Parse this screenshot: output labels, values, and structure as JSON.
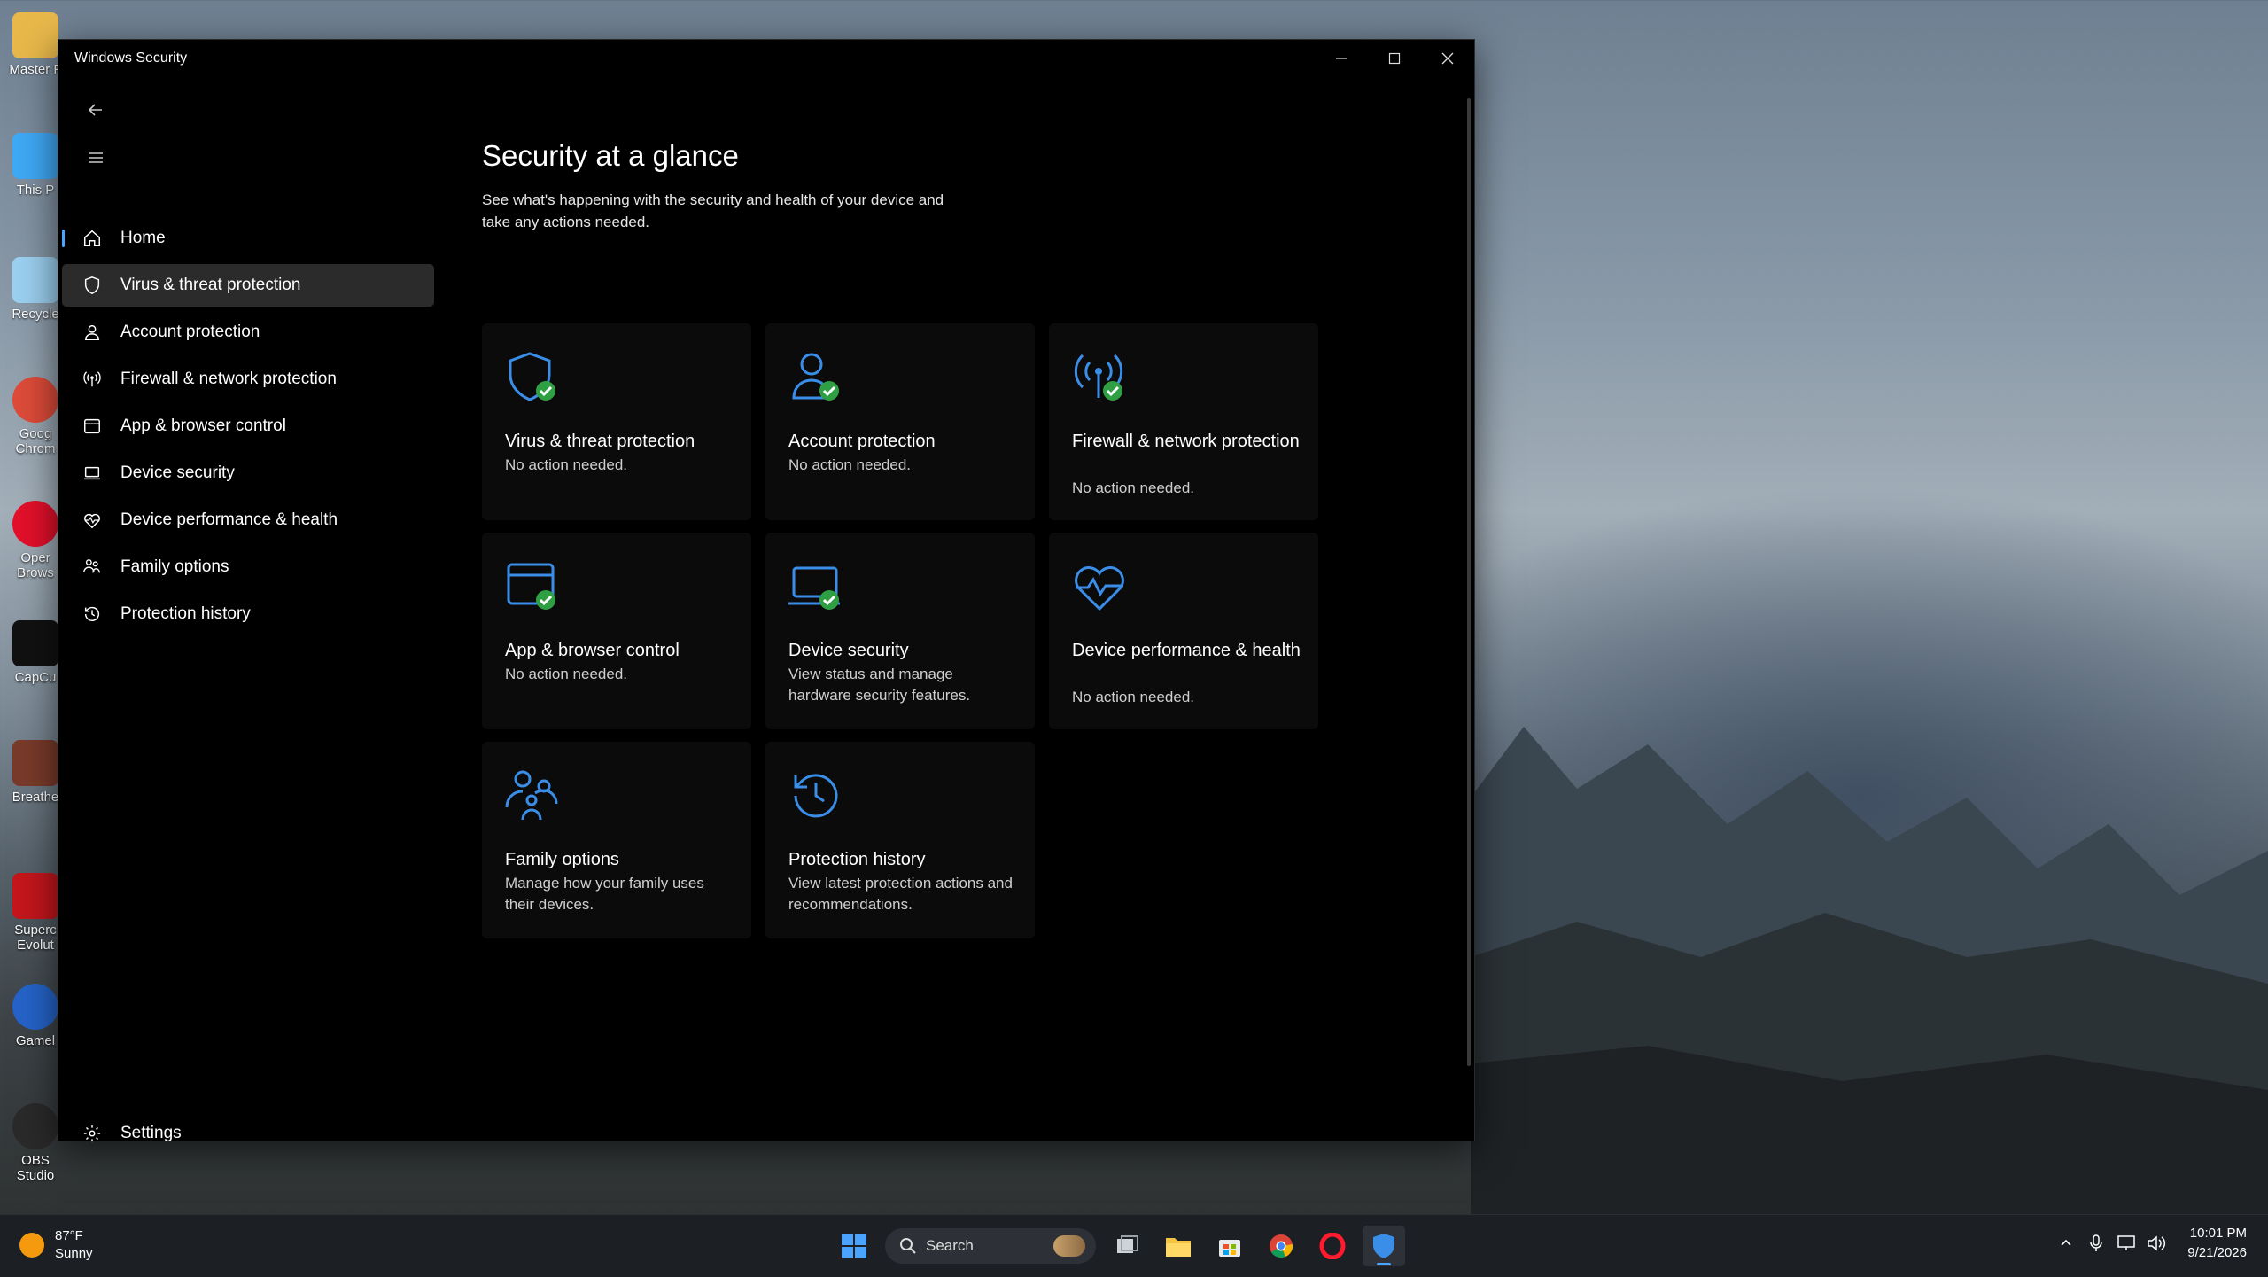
{
  "window": {
    "title": "Windows Security"
  },
  "nav": {
    "items": [
      {
        "label": "Home",
        "icon": "home-icon"
      },
      {
        "label": "Virus & threat protection",
        "icon": "shield-icon"
      },
      {
        "label": "Account protection",
        "icon": "person-icon"
      },
      {
        "label": "Firewall & network protection",
        "icon": "antenna-icon"
      },
      {
        "label": "App & browser control",
        "icon": "app-window-icon"
      },
      {
        "label": "Device security",
        "icon": "laptop-icon"
      },
      {
        "label": "Device performance & health",
        "icon": "heart-pulse-icon"
      },
      {
        "label": "Family options",
        "icon": "family-icon"
      },
      {
        "label": "Protection history",
        "icon": "history-icon"
      }
    ],
    "settings_label": "Settings"
  },
  "main": {
    "title": "Security at a glance",
    "subtitle": "See what's happening with the security and health of your device and take any actions needed.",
    "tiles": [
      {
        "name": "Virus & threat protection",
        "status": "No action needed.",
        "icon": "shield-check-icon"
      },
      {
        "name": "Account protection",
        "status": "No action needed.",
        "icon": "person-check-icon"
      },
      {
        "name": "Firewall & network protection",
        "status": "No action needed.",
        "icon": "antenna-check-icon"
      },
      {
        "name": "App & browser control",
        "status": "No action needed.",
        "icon": "app-window-check-icon"
      },
      {
        "name": "Device security",
        "status": "View status and manage hardware security features.",
        "icon": "laptop-check-icon"
      },
      {
        "name": "Device performance & health",
        "status": "No action needed.",
        "icon": "heart-pulse-icon"
      },
      {
        "name": "Family options",
        "status": "Manage how your family uses their devices.",
        "icon": "family-icon"
      },
      {
        "name": "Protection history",
        "status": "View latest protection actions and recommendations.",
        "icon": "history-icon"
      }
    ]
  },
  "desktop": {
    "icons": [
      "Master F",
      "This P",
      "Recycle",
      "Goog Chrom",
      "Oper Brows",
      "CapCu",
      "Breathe",
      "Superc Evolut",
      "Gamel",
      "OBS Studio"
    ]
  },
  "taskbar": {
    "weather_temp": "87°F",
    "weather_cond": "Sunny",
    "search_placeholder": "Search",
    "time": "10:01 PM",
    "date": "9/21/2026"
  },
  "colors": {
    "accent": "#4aa3ff",
    "icon_blue": "#3b8ee8",
    "check_green": "#2ea043",
    "window_bg": "#000000",
    "active_nav": "#2b2b2b"
  }
}
